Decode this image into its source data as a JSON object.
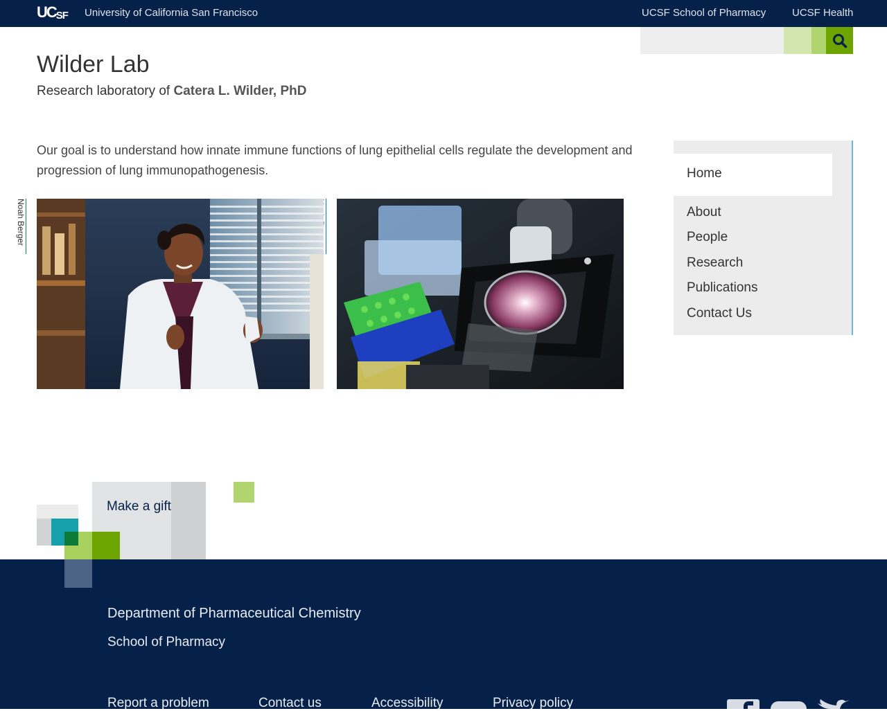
{
  "header": {
    "logo_text": "UC",
    "logo_text_small": "SF",
    "university_name": "University of California San Francisco",
    "links": [
      "UCSF School of Pharmacy",
      "UCSF Health"
    ]
  },
  "search": {
    "placeholder": ""
  },
  "page": {
    "title": "Wilder Lab",
    "subtitle_prefix": "Research laboratory of ",
    "subtitle_name": "Catera L. Wilder, PhD",
    "intro": "Our goal is to understand how innate immune functions of lung epithelial cells regulate the development and progression of lung immunopathogenesis."
  },
  "photos": [
    {
      "credit": "Noah Berger"
    },
    {
      "credit": "Noah Berger"
    }
  ],
  "nav": {
    "active": "Home",
    "items": [
      "About",
      "People",
      "Research",
      "Publications",
      "Contact Us"
    ]
  },
  "gift": {
    "label": "Make a gift"
  },
  "footer": {
    "department": "Department of Pharmaceutical Chemistry",
    "school": "School of Pharmacy",
    "links": [
      "Report a problem",
      "Contact us",
      "Accessibility",
      "Privacy policy"
    ],
    "social": [
      "facebook-icon",
      "youtube-icon",
      "twitter-icon"
    ]
  },
  "colors": {
    "navy": "#052049",
    "green": "#6ea400",
    "light_green": "#b1d56e",
    "teal": "#16a0ac",
    "nav_border": "#6fb6cf"
  }
}
